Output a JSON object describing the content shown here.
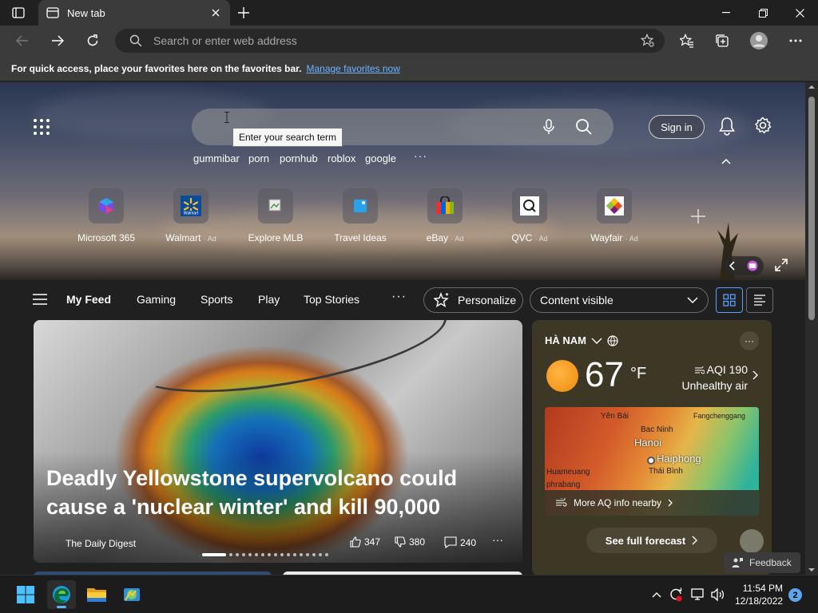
{
  "browser": {
    "tab_title": "New tab",
    "address_placeholder": "Search or enter web address",
    "favorites_msg": "For quick access, place your favorites here on the favorites bar.",
    "favorites_link": "Manage favorites now"
  },
  "hero": {
    "search_tooltip": "Enter your search term",
    "suggestions": [
      "gummibar",
      "porn",
      "pornhub",
      "roblox",
      "google"
    ],
    "signin_label": "Sign in",
    "tiles": [
      {
        "name": "Microsoft 365",
        "ad": ""
      },
      {
        "name": "Walmart",
        "ad": "· Ad"
      },
      {
        "name": "Explore MLB",
        "ad": ""
      },
      {
        "name": "Travel Ideas",
        "ad": ""
      },
      {
        "name": "eBay",
        "ad": "· Ad"
      },
      {
        "name": "QVC",
        "ad": "· Ad"
      },
      {
        "name": "Wayfair",
        "ad": "· Ad"
      }
    ]
  },
  "feed": {
    "tabs": [
      "My Feed",
      "Gaming",
      "Sports",
      "Play",
      "Top Stories"
    ],
    "personalize": "Personalize",
    "content_visibility": "Content visible"
  },
  "story": {
    "title": "Deadly Yellowstone supervolcano could cause a 'nuclear winter' and kill 90,000",
    "source": "The Daily Digest",
    "likes": "347",
    "dislikes": "380",
    "comments": "240"
  },
  "weather": {
    "location": "HÀ NAM",
    "temp": "67",
    "unit": "°F",
    "aqi": "AQI 190",
    "aqi_status": "Unhealthy air",
    "map_labels": {
      "yen_bai": "Yên Bái",
      "bac_ninh": "Bac Ninh",
      "fangchenggang": "Fangchenggang",
      "hanoi": "Hanoi",
      "haiphong": "Haiphong",
      "huameuang": "Huameuang",
      "thai_binh": "Thái Bình",
      "phrabang": "phrabang"
    },
    "aq_link": "More AQ info nearby",
    "forecast_button": "See full forecast"
  },
  "feedback_label": "Feedback",
  "taskbar": {
    "time": "11:54 PM",
    "date": "12/18/2022",
    "notifications": "2"
  }
}
